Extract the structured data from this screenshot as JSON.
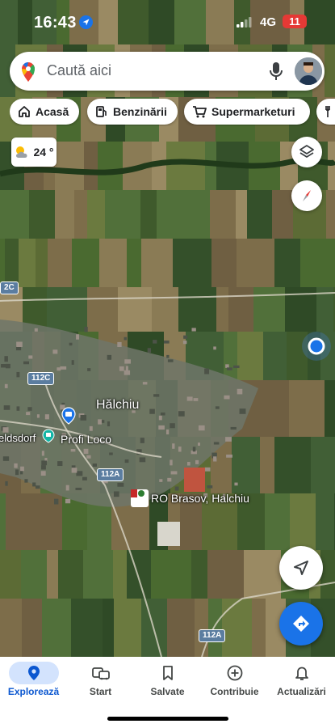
{
  "status_bar": {
    "time": "16:43",
    "network": "4G",
    "battery": "11"
  },
  "search": {
    "placeholder": "Caută aici"
  },
  "chips": [
    {
      "label": "Acasă",
      "icon": "home-icon"
    },
    {
      "label": "Benzinării",
      "icon": "gas-station-icon"
    },
    {
      "label": "Supermarketuri",
      "icon": "cart-icon"
    }
  ],
  "weather": {
    "temperature": "24 °",
    "icon": "partly-cloudy-icon"
  },
  "map": {
    "places": {
      "town": "Hălchiu",
      "town_partial": "eldsdorf",
      "store": "Profi Loco",
      "business": "RO Brasov, Halchiu"
    },
    "roads": [
      "2C",
      "112C",
      "112A",
      "112A"
    ]
  },
  "bottom_nav": [
    {
      "label": "Explorează",
      "icon": "explore-pin-icon",
      "active": true
    },
    {
      "label": "Start",
      "icon": "commute-icon",
      "active": false
    },
    {
      "label": "Salvate",
      "icon": "bookmark-icon",
      "active": false
    },
    {
      "label": "Contribuie",
      "icon": "add-circle-icon",
      "active": false
    },
    {
      "label": "Actualizări",
      "icon": "bell-icon",
      "active": false
    }
  ],
  "colors": {
    "accent": "#1a73e8",
    "battery": "#e53935",
    "active_tab_bg": "#d3e3fd"
  }
}
